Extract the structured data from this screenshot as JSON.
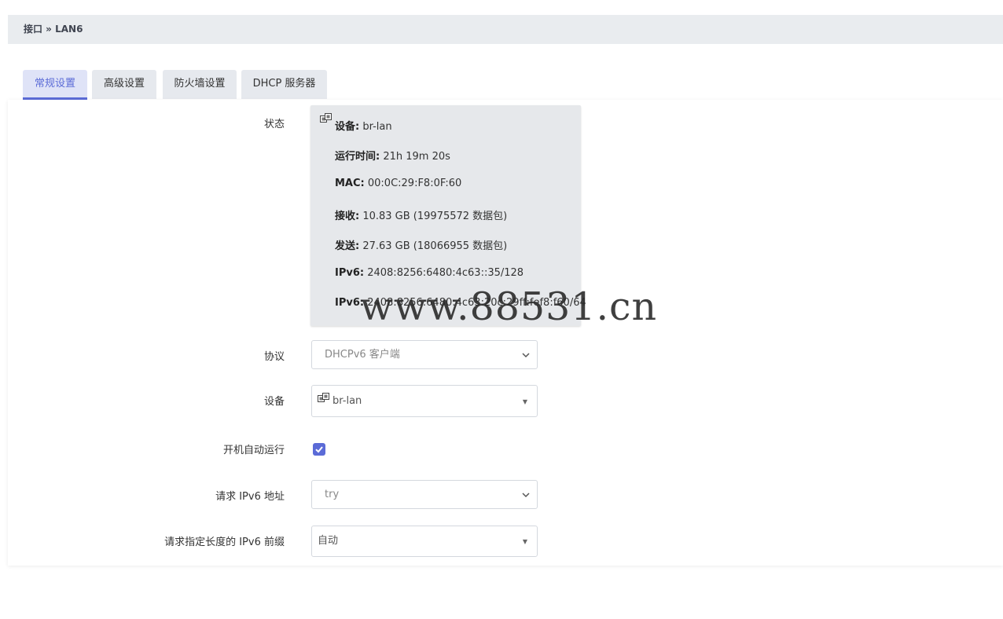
{
  "breadcrumb": "接口 » LAN6",
  "tabs": [
    {
      "label": "常规设置",
      "active": true
    },
    {
      "label": "高级设置",
      "active": false
    },
    {
      "label": "防火墙设置",
      "active": false
    },
    {
      "label": "DHCP 服务器",
      "active": false
    }
  ],
  "status": {
    "label": "状态",
    "lines": [
      {
        "key": "设备:",
        "value": " br-lan"
      },
      {
        "key": "运行时间:",
        "value": " 21h 19m 20s"
      },
      {
        "key": "MAC:",
        "value": " 00:0C:29:F8:0F:60"
      },
      {
        "key": "接收:",
        "value": " 10.83 GB (19975572 数据包)"
      },
      {
        "key": "发送:",
        "value": " 27.63 GB (18066955 数据包)"
      },
      {
        "key": "IPv6:",
        "value": " 2408:8256:6480:4c63::35/128"
      },
      {
        "key": "IPv6:",
        "value": " 2408:8256:6480:4c63:20c:29ff:fef8:f60/64"
      }
    ]
  },
  "fields": {
    "protocol": {
      "label": "协议",
      "value": "DHCPv6 客户端"
    },
    "device": {
      "label": "设备",
      "value": "br-lan"
    },
    "autostart": {
      "label": "开机自动运行",
      "checked": true
    },
    "reqaddress": {
      "label": "请求 IPv6 地址",
      "value": "try"
    },
    "reqprefix": {
      "label": "请求指定长度的 IPv6 前缀",
      "value": "自动"
    }
  },
  "watermark": "www.88531.cn",
  "colors": {
    "accent": "#5b6bd7",
    "breadcrumb_bg": "#e9ecef",
    "status_bg": "#e6e8eb"
  },
  "icons": {
    "device": "network-port-icon",
    "select": "chevron-down-icon",
    "check": "checkmark-icon"
  }
}
